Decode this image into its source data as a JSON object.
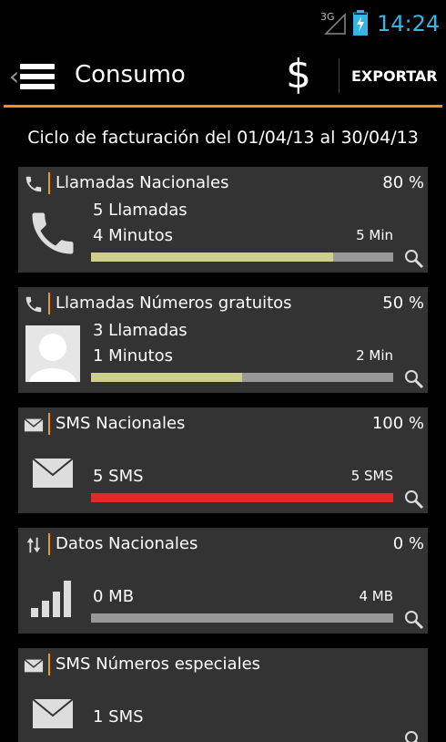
{
  "status": {
    "network": "3G",
    "time": "14:24"
  },
  "actionbar": {
    "title": "Consumo",
    "currency_symbol": "$",
    "export_label": "EXPORTAR"
  },
  "cycle_text": "Ciclo de facturación del 01/04/13 al 30/04/13",
  "colors": {
    "accent": "#f7901e",
    "ok_fill": "#cdcf8a",
    "full_fill": "#e02b27",
    "track": "#999999"
  },
  "cards": [
    {
      "title": "Llamadas Nacionales",
      "percent_label": "80 %",
      "fill_fraction": 0.8,
      "line1": "5 Llamadas",
      "line2": "4 Minutos",
      "limit": "5 Min",
      "header_icon": "phone-icon",
      "big_icon": "phone-icon"
    },
    {
      "title": "Llamadas Números gratuitos",
      "percent_label": "50 %",
      "fill_fraction": 0.5,
      "line1": "3 Llamadas",
      "line2": "1 Minutos",
      "limit": "2 Min",
      "header_icon": "phone-icon",
      "big_icon": "avatar-placeholder-icon"
    },
    {
      "title": "SMS Nacionales",
      "percent_label": "100 %",
      "fill_fraction": 1.0,
      "line1": "5 SMS",
      "line2": "",
      "limit": "5 SMS",
      "header_icon": "envelope-icon",
      "big_icon": "envelope-icon"
    },
    {
      "title": "Datos Nacionales",
      "percent_label": "0 %",
      "fill_fraction": 0.0,
      "line1": "0 MB",
      "line2": "",
      "limit": "4 MB",
      "header_icon": "data-arrows-icon",
      "big_icon": "signal-bars-icon"
    },
    {
      "title": "SMS Números especiales",
      "percent_label": "",
      "fill_fraction": 0.0,
      "line1": "1 SMS",
      "line2": "",
      "limit": "",
      "header_icon": "envelope-icon",
      "big_icon": "envelope-icon"
    }
  ]
}
